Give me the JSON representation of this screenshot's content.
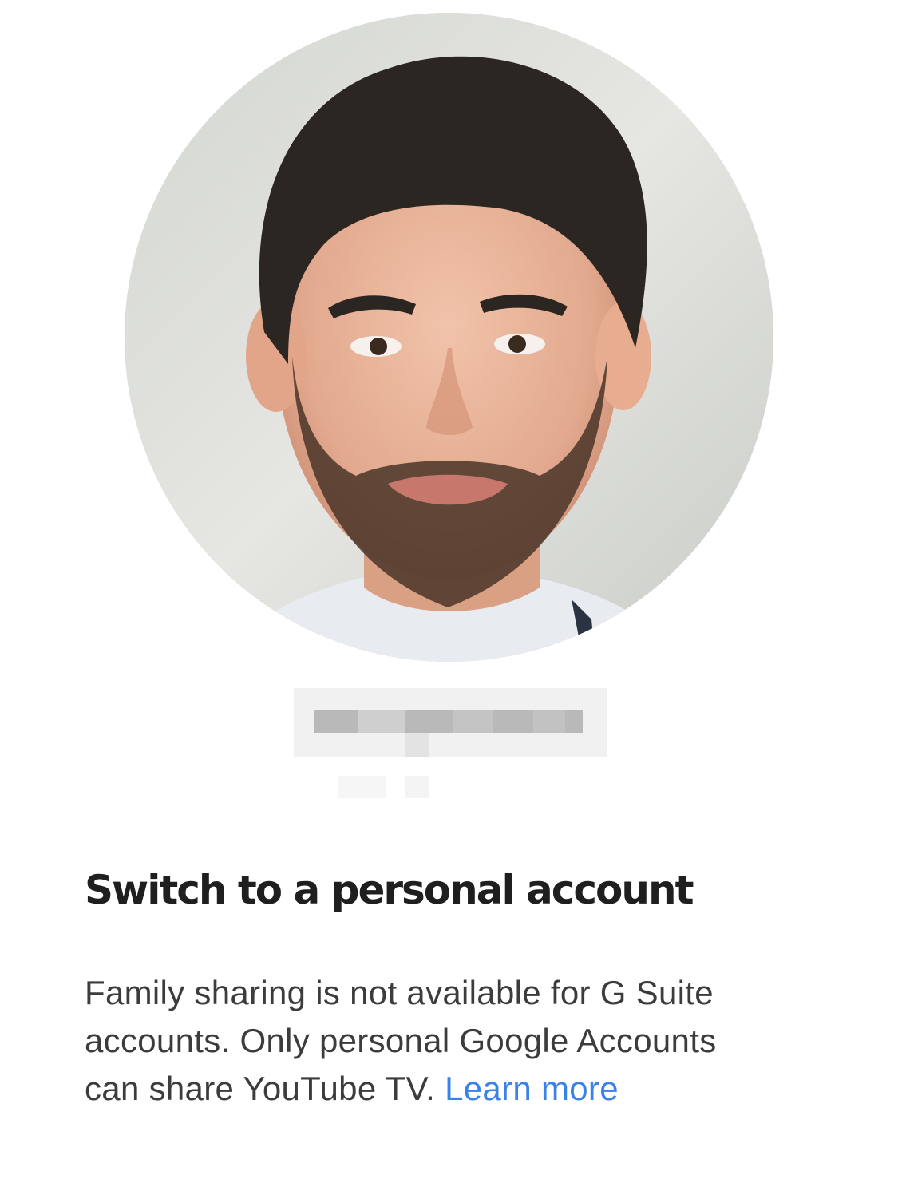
{
  "heading": "Switch to a personal account",
  "description_lines": [
    "Family sharing is not available for G Suite",
    "accounts. Only personal Google Accounts",
    "can share YouTube TV."
  ],
  "learn_more": "Learn more",
  "colors": {
    "heading": "#1f1f1f",
    "body_text": "#3c3c3c",
    "link": "#3b82e8"
  }
}
